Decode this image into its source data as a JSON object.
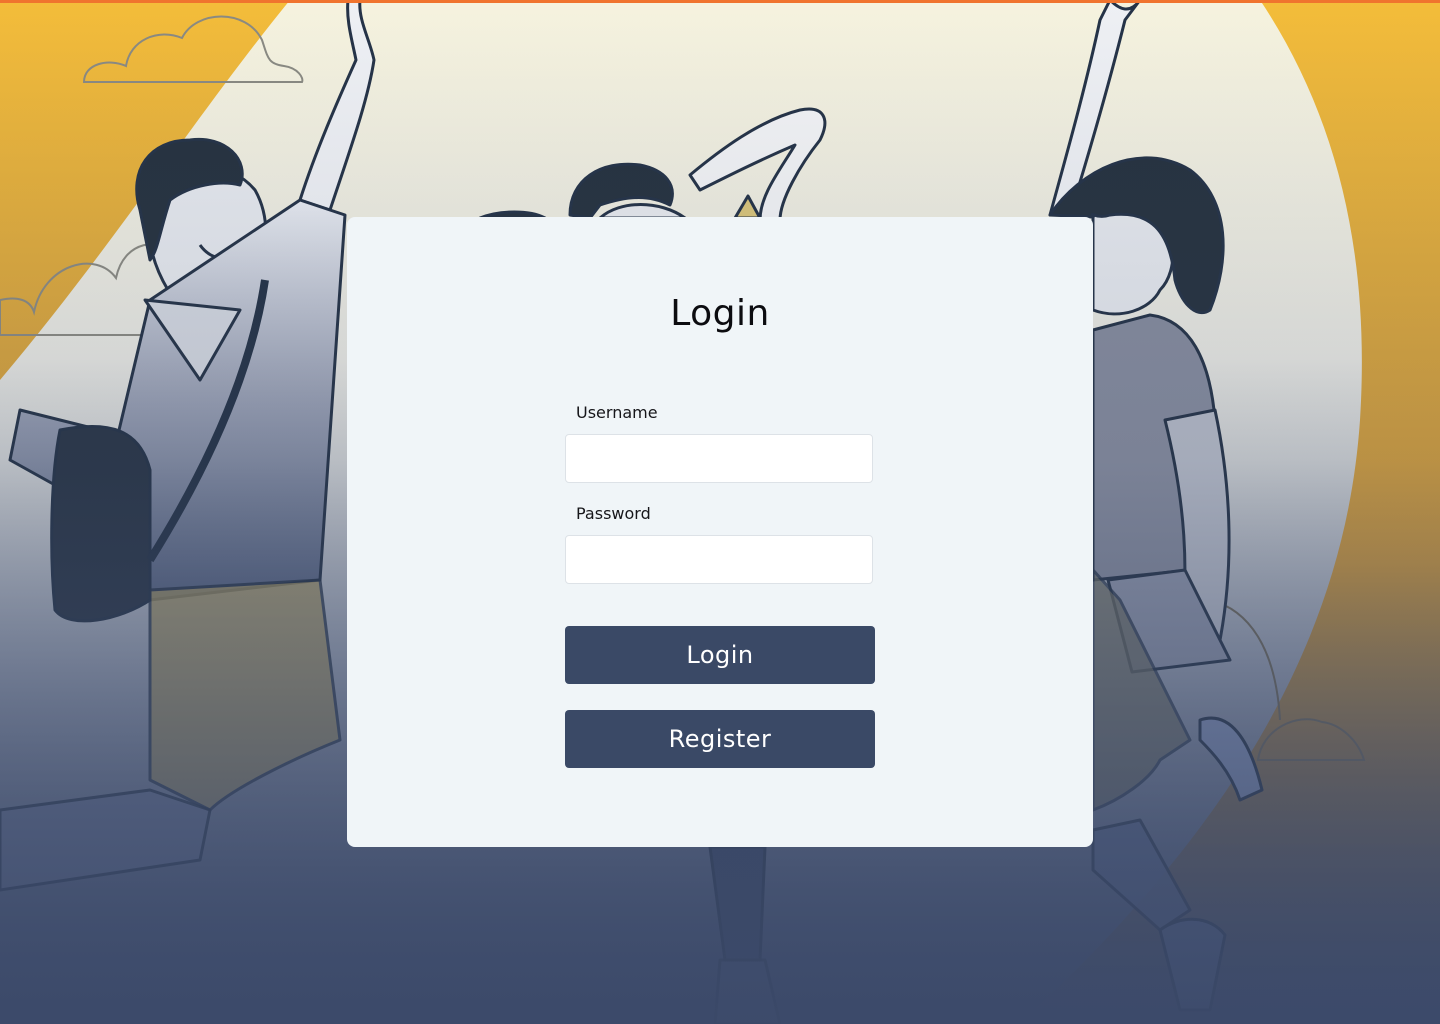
{
  "login_form": {
    "title": "Login",
    "username_label": "Username",
    "username_value": "",
    "password_label": "Password",
    "password_value": "",
    "login_button_label": "Login",
    "register_button_label": "Register"
  },
  "colors": {
    "background_orange": "#f4bd3a",
    "card_background": "#f0f5f8",
    "button_background": "#3a4966",
    "button_text": "#ffffff",
    "top_border": "#f0742e"
  },
  "illustration": {
    "subject": "three-people-jumping-celebration",
    "decorations": [
      "cloud-outline",
      "cloud-outline",
      "cloud-outline",
      "sun-circle"
    ]
  }
}
